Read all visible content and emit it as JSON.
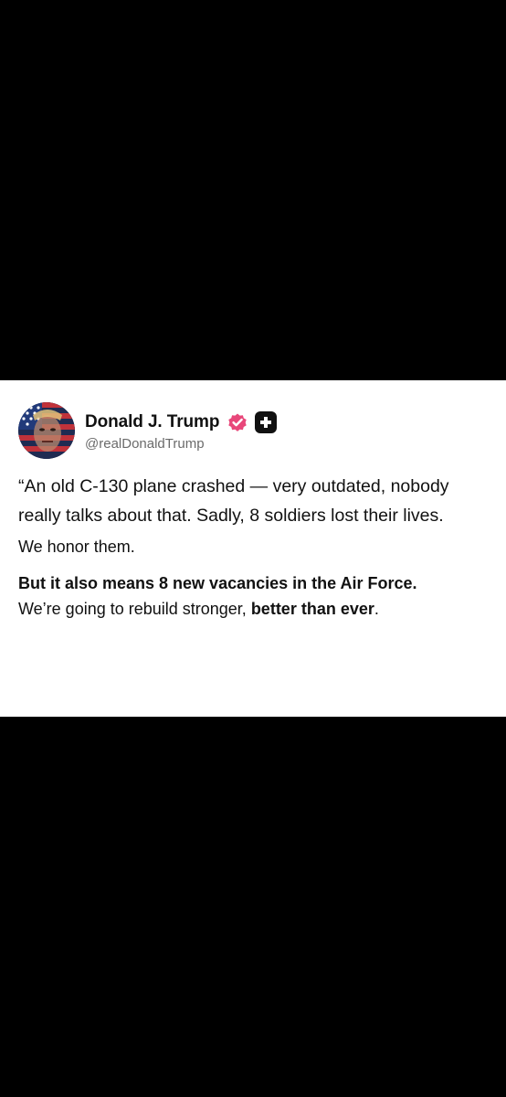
{
  "post": {
    "author": {
      "display_name": "Donald J. Trump",
      "handle": "@realDonaldTrump",
      "verified_color": "#e8477a",
      "badge_icon": "plus-icon"
    },
    "paragraphs": {
      "p1": "“An old C-130 plane crashed — very  outdated, nobody really talks about that. Sadly, 8 soldiers lost their lives.",
      "p2": "We honor them.",
      "p3_part1": "But it also means 8 new vacancies ",
      "p3_part2": "in the Air Force.",
      "p4_part1": "We’re going to rebuild stronger, ",
      "p4_part2": "better than ever",
      "p4_part3": "."
    }
  },
  "colors": {
    "background": "#000000",
    "card": "#ffffff",
    "text": "#111111",
    "handle": "#6b6b6b"
  }
}
